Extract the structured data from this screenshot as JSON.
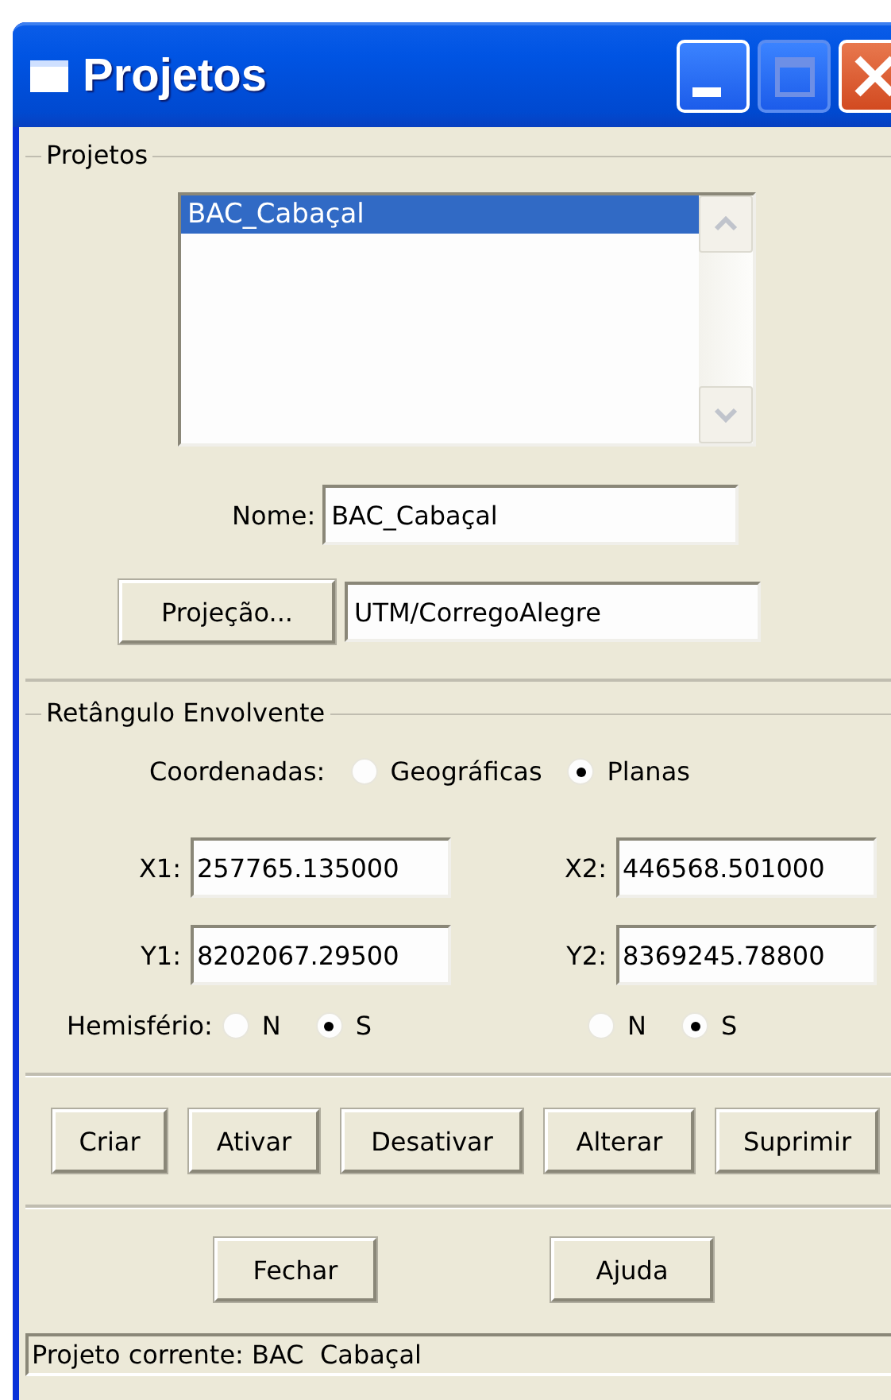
{
  "window": {
    "title": "Projetos"
  },
  "projects_group": {
    "legend": "Projetos",
    "list": [
      {
        "label": "BAC_Cabaçal",
        "selected": true
      }
    ],
    "name_label": "Nome:",
    "name_value": "BAC_Cabaçal",
    "projection_button": "Projeção...",
    "projection_value": "UTM/CorregoAlegre"
  },
  "bounds_group": {
    "legend": "Retângulo Envolvente",
    "coordinates_label": "Coordenadas:",
    "coordinates_options": [
      {
        "label": "Geográficas",
        "selected": false
      },
      {
        "label": "Planas",
        "selected": true
      }
    ],
    "fields": [
      {
        "label": "X1:",
        "value": "257765.135000"
      },
      {
        "label": "X2:",
        "value": "446568.501000"
      },
      {
        "label": "Y1:",
        "value": "8202067.29500"
      },
      {
        "label": "Y2:",
        "value": "8369245.78800"
      }
    ],
    "hemisphere_label": "Hemisfério:",
    "hemispheres": [
      {
        "options": [
          {
            "label": "N",
            "selected": false
          },
          {
            "label": "S",
            "selected": true
          }
        ]
      },
      {
        "options": [
          {
            "label": "N",
            "selected": false
          },
          {
            "label": "S",
            "selected": true
          }
        ]
      }
    ]
  },
  "action_buttons": [
    "Criar",
    "Ativar",
    "Desativar",
    "Alterar",
    "Suprimir"
  ],
  "bottom_buttons": [
    "Fechar",
    "Ajuda"
  ],
  "status_bar": "Projeto corrente: BAC  Cabaçal"
}
